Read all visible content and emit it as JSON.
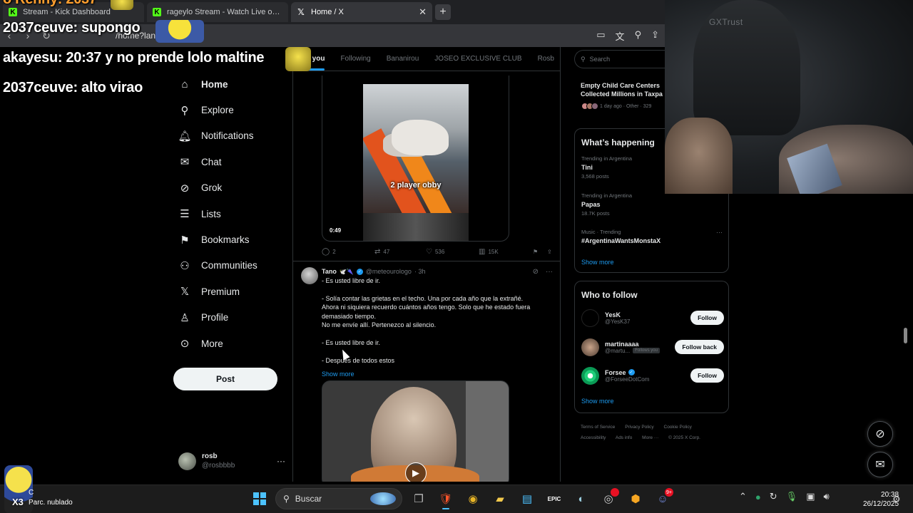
{
  "browser": {
    "tabs": [
      {
        "label": "Stream - Kick Dashboard",
        "favicon": "kick-icon"
      },
      {
        "label": "rageylo Stream - Watch Live on Kick",
        "favicon": "kick-icon"
      },
      {
        "label": "Home / X",
        "favicon": "x-icon"
      }
    ],
    "tab_close": "✕",
    "new_tab": "+",
    "url": "/home?lang=es"
  },
  "nav": {
    "items": [
      {
        "label": "Home",
        "icon": "home-icon",
        "glyph": "⌂"
      },
      {
        "label": "Explore",
        "icon": "search-icon",
        "glyph": "⚲"
      },
      {
        "label": "Notifications",
        "icon": "bell-icon",
        "glyph": "♫"
      },
      {
        "label": "Chat",
        "icon": "mail-icon",
        "glyph": "✉"
      },
      {
        "label": "Grok",
        "icon": "grok-icon",
        "glyph": "⊘"
      },
      {
        "label": "Lists",
        "icon": "list-icon",
        "glyph": "☰"
      },
      {
        "label": "Bookmarks",
        "icon": "bookmark-icon",
        "glyph": "⚑"
      },
      {
        "label": "Communities",
        "icon": "people-icon",
        "glyph": "⚇"
      },
      {
        "label": "Premium",
        "icon": "x-logo-icon",
        "glyph": "𝕏"
      },
      {
        "label": "Profile",
        "icon": "person-icon",
        "glyph": "⚲"
      },
      {
        "label": "More",
        "icon": "more-circle-icon",
        "glyph": "⊙"
      }
    ],
    "post_button": "Post",
    "account": {
      "name": "rosb",
      "handle": "@rosbbbb",
      "more": "···"
    }
  },
  "feed": {
    "tabs": [
      "r you",
      "Following",
      "Bananirou",
      "JOSEO EXCLUSIVE CLUB",
      "Rosb",
      "sha"
    ],
    "post1": {
      "video_caption": "2 player obby",
      "duration": "0:49",
      "replies": "2",
      "reposts": "47",
      "likes": "536",
      "views": "15K"
    },
    "post2": {
      "name": "Tano",
      "emoji": "🕊️🌂",
      "handle": "@meteourologo",
      "time": "· 3h",
      "lines": [
        "- Es usted libre de ir.",
        "",
        "- Solía contar las grietas en el techo. Una por cada año que la extrañé.",
        "Ahora ni siquiera recuerdo cuántos años tengo. Solo que he estado fuera",
        "demasiado tiempo.",
        "No me envíe allí. Pertenezco al silencio.",
        "",
        "- Es usted libre de ir.",
        "",
        "- Después de todos estos"
      ],
      "show_more": "Show more",
      "play": "▶"
    }
  },
  "right": {
    "search_placeholder": "Search",
    "news": {
      "title_1": "Empty Child Care Centers",
      "title_2": "Collected Millions in Taxpa",
      "meta": "1 day ago · Other · 329"
    },
    "happening": {
      "title": "What’s happening",
      "trends": [
        {
          "context": "Trending in Argentina",
          "name": "Tini",
          "count": "3,568 posts"
        },
        {
          "context": "Trending in Argentina",
          "name": "Papas",
          "count": "18.7K posts"
        },
        {
          "context": "Music · Trending",
          "name": "#ArgentinaWantsMonstaX",
          "count": ""
        }
      ],
      "show_more": "Show more"
    },
    "who_to_follow": {
      "title": "Who to follow",
      "accounts": [
        {
          "name": "YesK",
          "handle": "@YesK37",
          "badge": "",
          "button": "Follow",
          "verified": false
        },
        {
          "name": "martinaaaa",
          "handle": "@martu...",
          "badge": "Follows you",
          "button": "Follow back",
          "verified": false
        },
        {
          "name": "Forsee",
          "handle": "@ForseeDotCom",
          "badge": "",
          "button": "Follow",
          "verified": true
        }
      ],
      "show_more": "Show more"
    },
    "footer": [
      "Terms of Service",
      "Privacy Policy",
      "Cookie Policy",
      "Accessibility",
      "Ads info",
      "More ···",
      "© 2025 X Corp."
    ]
  },
  "overlay": {
    "chat": [
      {
        "user": "2037ceuve",
        "text": ": supongo"
      },
      {
        "user": "akayesu",
        "text": ": 20:37 y no prende lolo maltine"
      },
      {
        "user": "2037ceuve",
        "text": ": alto virao"
      }
    ],
    "top_fragment": "o Renny: 2037",
    "webcam_label": "GXTrust"
  },
  "taskbar": {
    "weather_temp": "C",
    "weather_desc": "Parc. nublado",
    "emote_tag": "X3",
    "search": "Buscar",
    "discord_badge": "9+",
    "time": "20:38",
    "date": "26/12/2025"
  }
}
